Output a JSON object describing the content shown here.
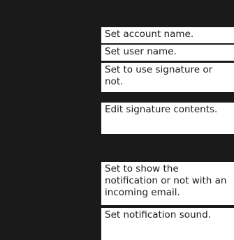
{
  "settings": {
    "rows": [
      {
        "label": "Set account name."
      },
      {
        "label": "Set user name."
      },
      {
        "label": "Set to use signature or not."
      },
      {
        "label": "Edit signature contents."
      },
      {
        "label": "Set to show the notification or not with an incoming email."
      },
      {
        "label": "Set notification sound."
      }
    ]
  }
}
